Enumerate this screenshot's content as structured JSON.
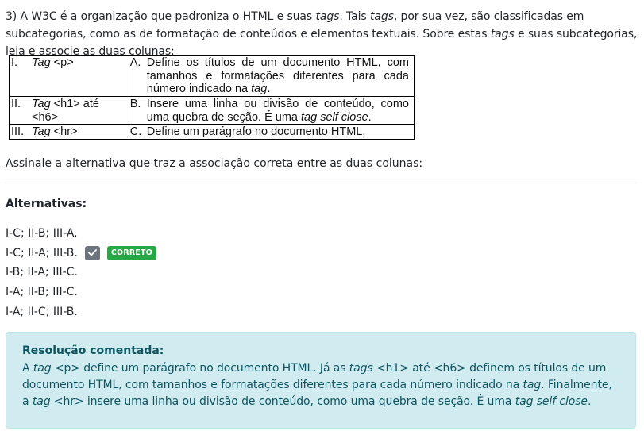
{
  "question": {
    "parts": [
      "3) A W3C é a organização que padroniza o HTML e suas ",
      "tags",
      ". Tais ",
      "tags",
      ", por sua vez, são classificadas em subcategorias, como as de formatação de conteúdos e elementos textuais. Sobre estas ",
      "tags",
      " e suas subcategorias, leia e associe as duas colunas:"
    ]
  },
  "table": {
    "rows": [
      {
        "left_num": "I.",
        "left_parts": [
          "Tag",
          " <p>"
        ],
        "right_num": "A.",
        "right_parts": [
          "Define os títulos de um documento HTML, com tamanhos e formatações diferentes para cada número indicado na ",
          "tag",
          "."
        ]
      },
      {
        "left_num": "II.",
        "left_parts": [
          "Tag",
          " <h1> até <h6>"
        ],
        "right_num": "B.",
        "right_parts": [
          "Insere uma linha ou divisão de conteúdo, como uma quebra de seção. É uma ",
          "tag self close",
          "."
        ]
      },
      {
        "left_num": "III.",
        "left_parts": [
          "Tag",
          " <hr>"
        ],
        "right_num": "C.",
        "right_parts": [
          "Define um parágrafo no documento HTML.",
          "",
          ""
        ]
      }
    ]
  },
  "instruction": "Assinale a alternativa que traz a associação correta entre as duas colunas:",
  "alternatives_title": "Alternativas:",
  "alternatives": [
    {
      "label": "I-C; II-B; III-A."
    },
    {
      "label": "I-C; II-A; III-B.",
      "selected_icon": "check-icon",
      "badge": "CORRETO"
    },
    {
      "label": "I-B; II-A; III-C."
    },
    {
      "label": "I-A; II-B; III-C."
    },
    {
      "label": "I-A; II-C; III-B."
    }
  ],
  "resolution": {
    "title": "Resolução comentada:",
    "parts": [
      "A ",
      "tag",
      " <p> define um parágrafo no documento HTML. Já as ",
      "tags",
      " <h1> até <h6> definem os títulos de um documento HTML, com tamanhos e formatações diferentes para cada número indicado na ",
      "tag",
      ". Finalmente, a ",
      "tag",
      " <hr> insere uma linha ou divisão de conteúdo, como uma quebra de seção. É uma ",
      "tag self close",
      "."
    ]
  },
  "colors": {
    "correct_badge": "#28a745",
    "check_badge": "#6c757d",
    "resolution_bg": "#d1ecf1",
    "resolution_text": "#0c5460"
  }
}
